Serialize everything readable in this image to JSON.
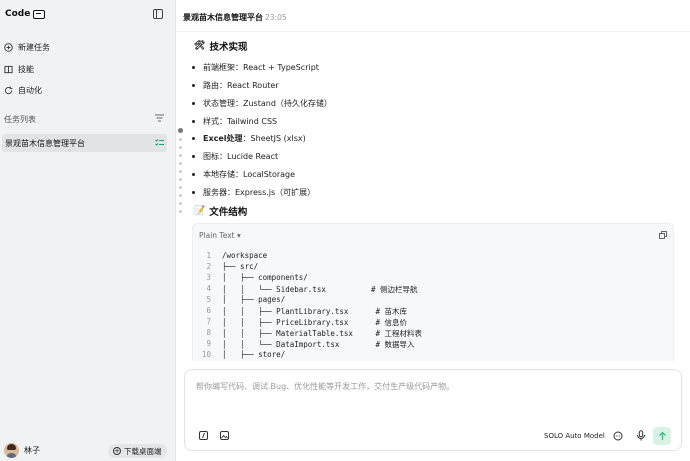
{
  "sidebar": {
    "brand": "Code",
    "nav": [
      {
        "label": "新建任务",
        "icon": "new-task-icon"
      },
      {
        "label": "技能",
        "icon": "book-icon"
      },
      {
        "label": "自动化",
        "icon": "refresh-icon"
      }
    ],
    "task_section_label": "任务列表",
    "tasks": [
      {
        "label": "景观苗木信息管理平台",
        "icon": "list-check-icon"
      }
    ],
    "user": {
      "name": "林子"
    },
    "download_label": "下载桌面端"
  },
  "header": {
    "title": "景观苗木信息管理平台",
    "time": "23:05"
  },
  "content": {
    "tech_heading": "技术实现",
    "tech_items": [
      {
        "label": "",
        "value": "前端框架：React + TypeScript"
      },
      {
        "label": "",
        "value": "路由：React Router"
      },
      {
        "label": "",
        "value": "状态管理：Zustand（持久化存储）"
      },
      {
        "label": "",
        "value": "样式：Tailwind CSS"
      },
      {
        "label": "Excel处理",
        "value": "：SheetJS (xlsx)"
      },
      {
        "label": "",
        "value": "图标：Lucide React"
      },
      {
        "label": "",
        "value": "本地存储：LocalStorage"
      },
      {
        "label": "",
        "value": "服务器：Express.js（可扩展）"
      }
    ],
    "structure_heading": "文件结构",
    "code": {
      "language": "Plain Text",
      "lines": [
        "/workspace",
        "├── src/",
        "│   ├── components/",
        "│   │   └── Sidebar.tsx          # 侧边栏导航",
        "│   ├── pages/",
        "│   │   ├── PlantLibrary.tsx      # 苗木库",
        "│   │   ├── PriceLibrary.tsx      # 信息价",
        "│   │   ├── MaterialTable.tsx     # 工程材料表",
        "│   │   └── DataImport.tsx        # 数据导入",
        "│   ├── store/"
      ]
    }
  },
  "composer": {
    "placeholder": "帮你编写代码、调试 Bug、优化性能等开发工作，交付生产级代码产物。",
    "model": "SOLO Auto Model",
    "accent": "#d8f3e5"
  }
}
